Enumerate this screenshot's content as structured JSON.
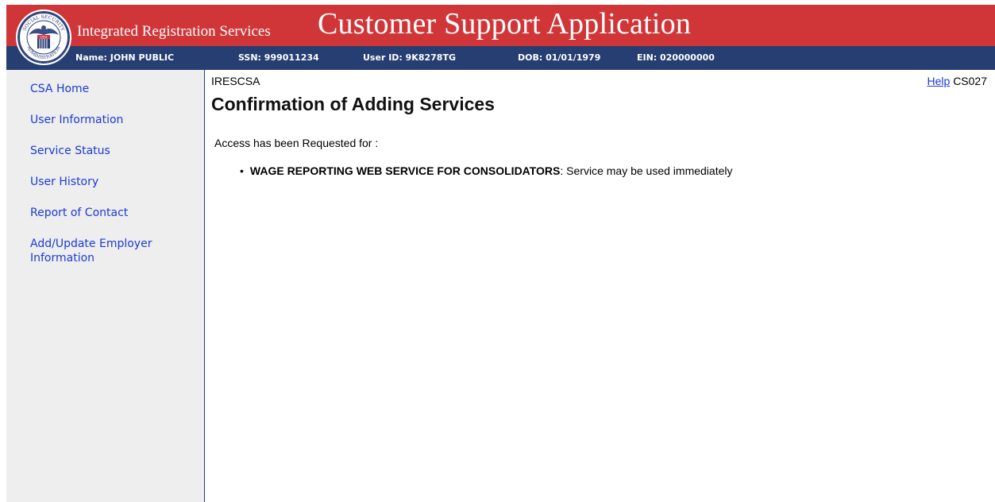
{
  "header": {
    "app_name": "Integrated Registration Services",
    "app_title": "Customer Support Application",
    "colors": {
      "banner": "#d03638",
      "infobar": "#263e72",
      "link": "#1a3bd4"
    },
    "seal": {
      "top_text": "SOCIAL SECURITY",
      "bottom_text": "ADMINISTRATION",
      "center_text": "USA"
    },
    "info": {
      "name": "Name: JOHN PUBLIC",
      "ssn": "SSN: 999011234",
      "user_id": "User ID: 9K8278TG",
      "dob": "DOB: 01/01/1979",
      "ein": "EIN: 020000000"
    }
  },
  "sidebar": {
    "items": [
      {
        "label": "CSA Home"
      },
      {
        "label": "User Information"
      },
      {
        "label": "Service Status"
      },
      {
        "label": "User History"
      },
      {
        "label": "Report of Contact"
      },
      {
        "label": "Add/Update Employer Information"
      }
    ]
  },
  "main": {
    "system_code": "IRESCSA",
    "help_label": "Help",
    "page_code": "CS027",
    "heading": "Confirmation of Adding Services",
    "intro": "Access has been Requested for :",
    "services": [
      {
        "name": "WAGE REPORTING WEB SERVICE FOR CONSOLIDATORS",
        "status": ": Service may be used immediately"
      }
    ]
  }
}
